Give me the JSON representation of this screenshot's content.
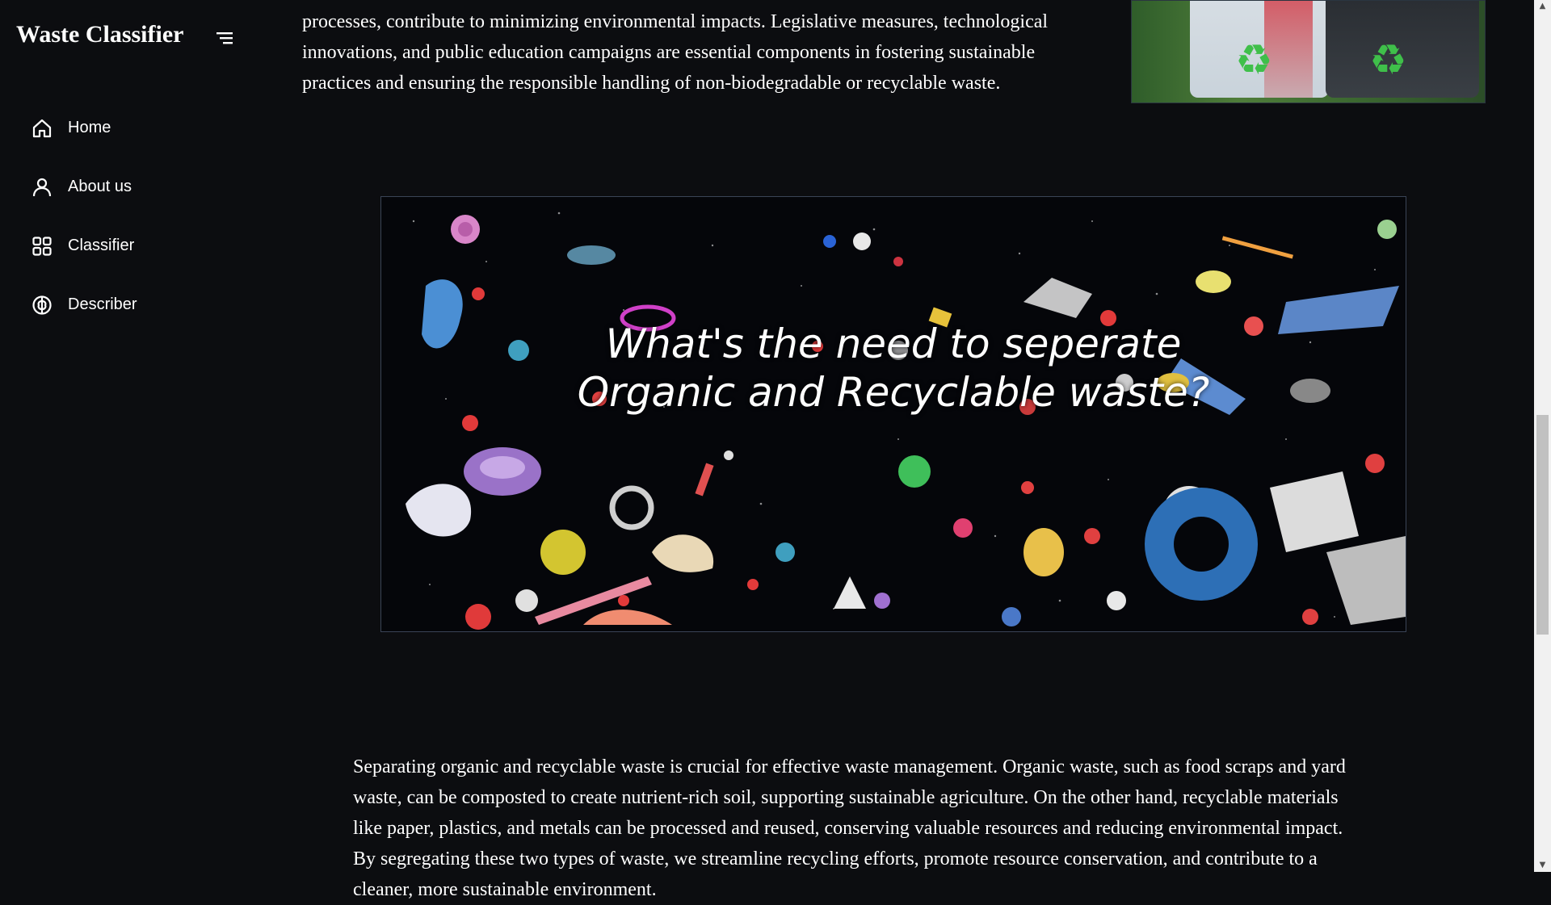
{
  "sidebar": {
    "brand": "Waste Classifier",
    "menu_toggle_icon": "menu-lines-icon",
    "items": [
      {
        "label": "Home",
        "icon": "home-icon"
      },
      {
        "label": "About us",
        "icon": "user-icon"
      },
      {
        "label": "Classifier",
        "icon": "grid-icon"
      },
      {
        "label": "Describer",
        "icon": "brain-icon"
      }
    ]
  },
  "main": {
    "intro_text": "processes, contribute to minimizing environmental impacts. Legislative measures, technological innovations, and public education campaigns are essential components in fostering sustainable practices and ensuring the responsible handling of non-biodegradable or recyclable waste.",
    "hero_title_line1": "What's the need to seperate",
    "hero_title_line2": "Organic and Recyclable waste?",
    "body_text": "Separating organic and recyclable waste is crucial for effective waste management. Organic waste, such as food scraps and yard waste, can be composted to create nutrient-rich soil, supporting sustainable agriculture. On the other hand, recyclable materials like paper, plastics, and metals can be processed and reused, conserving valuable resources and reducing environmental impact. By segregating these two types of waste, we streamline recycling efforts, promote resource conservation, and contribute to a cleaner, more sustainable environment."
  },
  "colors": {
    "background": "#0c0d10",
    "text": "#ffffff",
    "recycle_green": "#3fbf4a"
  }
}
